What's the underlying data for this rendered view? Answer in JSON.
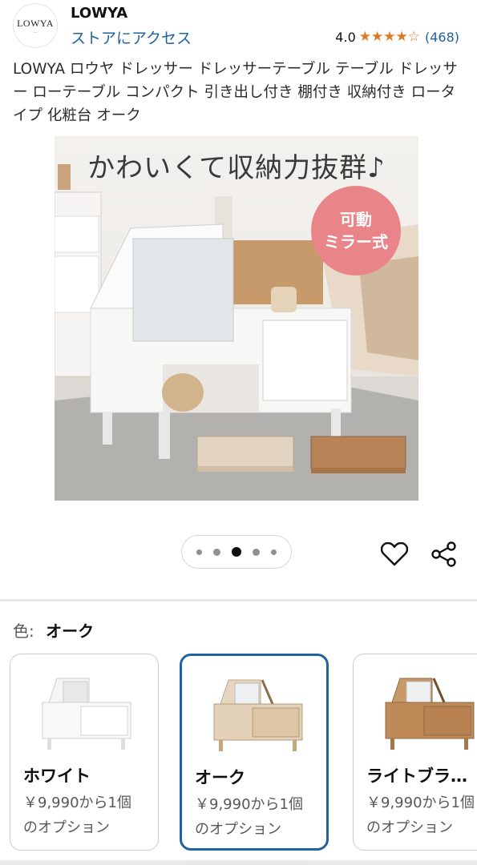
{
  "header": {
    "logo_text": "LOWYA",
    "brand_name": "LOWYA",
    "store_link": "ストアにアクセス",
    "rating_value": "4.0",
    "rating_count": "(468)",
    "stars": 4.0
  },
  "product": {
    "title": "LOWYA ロウヤ ドレッサー ドレッサーテーブル テーブル ドレッサー ローテーブル コンパクト 引き出し付き 棚付き 収納付き ロータイプ 化粧台 オーク"
  },
  "hero": {
    "caption": "かわいくて収納力抜群♪",
    "badge_line1": "可動",
    "badge_line2": "ミラー式"
  },
  "carousel": {
    "count": 5,
    "active_index": 2
  },
  "colors": {
    "accent": "#2162a1",
    "star": "#de7921",
    "badge": "#e98589"
  },
  "variation": {
    "label": "色:",
    "selected": "オーク",
    "options": [
      {
        "name": "ホワイト",
        "price_line1": "￥9,990から1個",
        "price_line2": "のオプション"
      },
      {
        "name": "オーク",
        "price_line1": "￥9,990から1個",
        "price_line2": "のオプション"
      },
      {
        "name": "ライトブラ…",
        "price_line1": "￥9,990から1個",
        "price_line2": "のオプション"
      }
    ]
  }
}
